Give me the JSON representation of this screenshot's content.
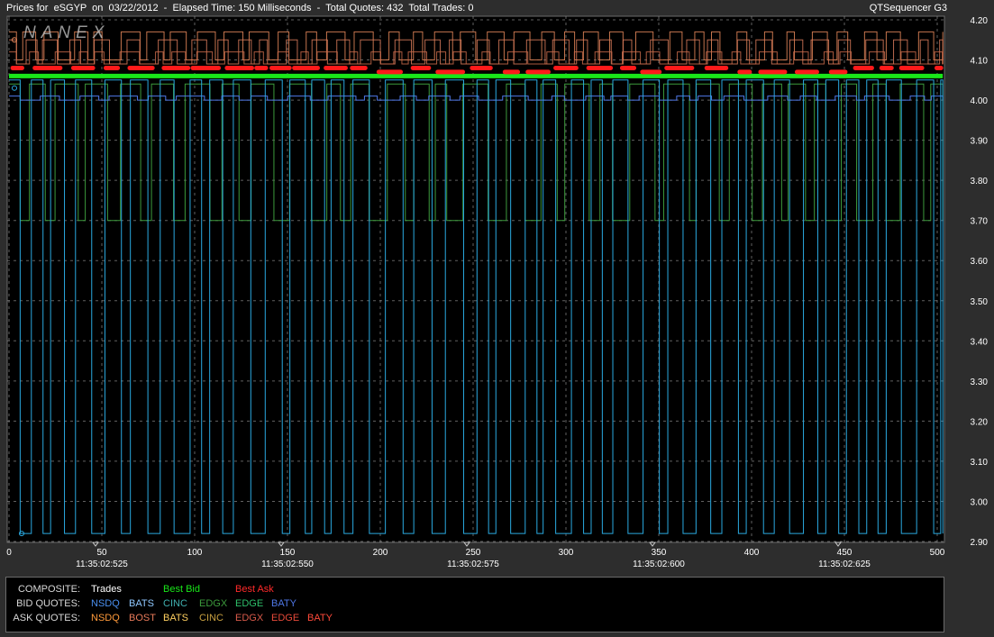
{
  "header": {
    "title": "Prices for  eSGYP  on  03/22/2012  -  Elapsed Time: 150 Milliseconds  -  Total Quotes: 432  Total Trades: 0",
    "app_name": "QTSequencer G3",
    "watermark": "NANEX"
  },
  "colors": {
    "background": "#000000",
    "frame": "#2d2d2d",
    "grid": "#8a8a8a",
    "best_bid": "#19e619",
    "best_ask": "#ff1a1a",
    "bid_nsdq": "#2aa9e0",
    "bid_cinc": "#3c9a3c",
    "ask_lines": "#e8885a"
  },
  "chart_data": {
    "type": "line",
    "title": "Prices for eSGYP on 03/22/2012",
    "xlabel": "",
    "ylabel": "",
    "xlim": [
      0,
      505
    ],
    "ylim": [
      2.9,
      4.2
    ],
    "x_ticks": [
      0,
      50,
      100,
      150,
      200,
      250,
      300,
      350,
      400,
      450,
      500
    ],
    "y_ticks": [
      "4.20",
      "4.10",
      "4.00",
      "3.90",
      "3.80",
      "3.70",
      "3.60",
      "3.50",
      "3.40",
      "3.30",
      "3.20",
      "3.10",
      "3.00",
      "2.90"
    ],
    "time_labels": [
      {
        "x": 50,
        "label": "11:35:02:525"
      },
      {
        "x": 150,
        "label": "11:35:02:550"
      },
      {
        "x": 250,
        "label": "11:35:02:575"
      },
      {
        "x": 350,
        "label": "11:35:02:600"
      },
      {
        "x": 450,
        "label": "11:35:02:625"
      }
    ],
    "grid": true,
    "series": [
      {
        "name": "Best Ask",
        "level": 4.08,
        "low": 4.07,
        "high": 4.08
      },
      {
        "name": "Best Bid",
        "level": 4.06,
        "low": 4.06,
        "high": 4.06
      },
      {
        "name": "NSDQ",
        "side": "bid",
        "high": 4.05,
        "low": 2.92
      },
      {
        "name": "CINC",
        "side": "bid",
        "high": 4.04,
        "low": 3.7
      },
      {
        "name": "BATY",
        "side": "bid",
        "high": 4.01,
        "low": 4.0
      },
      {
        "name": "NSDQ",
        "side": "ask",
        "high": 4.17,
        "low": 4.1
      },
      {
        "name": "BOST",
        "side": "ask",
        "high": 4.15,
        "low": 4.09
      },
      {
        "name": "EDGX",
        "side": "ask",
        "high": 4.12,
        "low": 4.09
      }
    ]
  },
  "legend": {
    "rows": [
      {
        "head": "COMPOSITE:",
        "items": [
          {
            "label": "Trades",
            "color": "#ffffff"
          },
          {
            "label": "Best Bid",
            "color": "#19e619"
          },
          {
            "label": "Best Ask",
            "color": "#ff2a2a"
          }
        ]
      },
      {
        "head": "BID QUOTES:",
        "items": [
          {
            "label": "NSDQ",
            "color": "#4a8ff0"
          },
          {
            "label": "BATS",
            "color": "#8fc8ff"
          },
          {
            "label": "CINC",
            "color": "#40b0b0"
          },
          {
            "label": "EDGX",
            "color": "#3c9a3c"
          },
          {
            "label": "EDGE",
            "color": "#2ebf6a"
          },
          {
            "label": "BATY",
            "color": "#4f78e8"
          }
        ]
      },
      {
        "head": "ASK QUOTES:",
        "items": [
          {
            "label": "NSDQ",
            "color": "#ff9a3a"
          },
          {
            "label": "BOST",
            "color": "#e87a5a"
          },
          {
            "label": "BATS",
            "color": "#ffd060"
          },
          {
            "label": "CINC",
            "color": "#c8a040"
          },
          {
            "label": "EDGX",
            "color": "#d85a4a"
          },
          {
            "label": "EDGE",
            "color": "#e84a3a"
          },
          {
            "label": "BATY",
            "color": "#ff4a3a"
          }
        ]
      }
    ]
  }
}
